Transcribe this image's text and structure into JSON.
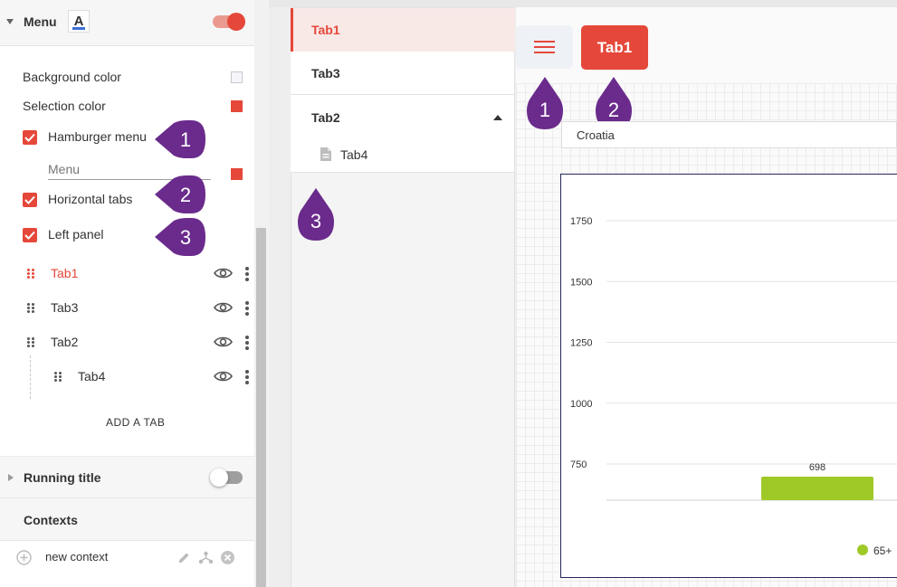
{
  "panel": {
    "menu_section": {
      "title": "Menu",
      "toggle_on": true
    },
    "background_color_label": "Background color",
    "selection_color_label": "Selection color",
    "hamburger_label": "Hamburger menu",
    "menu_input_placeholder": "Menu",
    "horizontal_tabs_label": "Horizontal tabs",
    "left_panel_label": "Left panel",
    "tabs": [
      {
        "label": "Tab1",
        "selected": true
      },
      {
        "label": "Tab3",
        "selected": false
      },
      {
        "label": "Tab2",
        "selected": false
      },
      {
        "label": "Tab4",
        "selected": false
      }
    ],
    "add_tab_label": "ADD A TAB",
    "running_title": {
      "label": "Running title",
      "toggle_on": false
    },
    "contexts_label": "Contexts",
    "new_context_label": "new context"
  },
  "markers": [
    "1",
    "2",
    "3"
  ],
  "tabcol": {
    "items": [
      "Tab1",
      "Tab3",
      "Tab2"
    ],
    "child": "Tab4"
  },
  "content": {
    "tab_button": "Tab1",
    "country": "Croatia"
  },
  "chart_data": {
    "type": "bar",
    "ylim": [
      600,
      1900
    ],
    "yticks": [
      "1750",
      "1500",
      "1250",
      "1000",
      "750"
    ],
    "categories": [
      ""
    ],
    "series": [
      {
        "name": "65+",
        "values": [
          698
        ],
        "color": "#9fc927"
      }
    ]
  },
  "colors": {
    "accent": "#e5483a",
    "marker": "#6a2b8c",
    "bar": "#9fc927"
  }
}
